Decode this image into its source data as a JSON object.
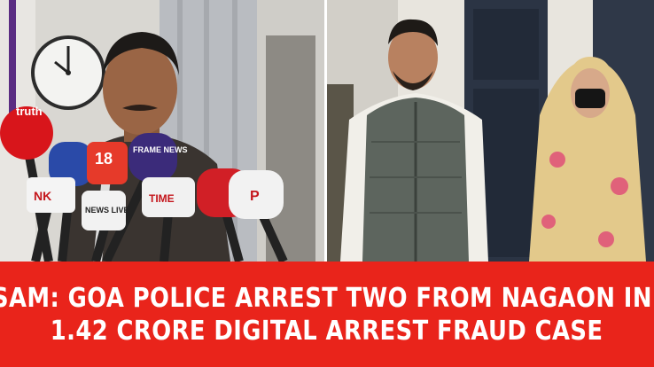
{
  "image": {
    "left_photo": {
      "scene": "speaker-at-press-microphones",
      "mic_labels": [
        "truth",
        "18",
        "FRAME NEWS",
        "NK",
        "NEWS LIVE",
        "TIME",
        "P"
      ]
    },
    "right_photo": {
      "scene": "two-people-standing-in-corridor"
    }
  },
  "headline": {
    "line1": "ASSAM: GOA POLICE ARREST TWO FROM NAGAON IN RS",
    "line2": "1.42 CRORE DIGITAL ARREST FRAUD CASE"
  },
  "colors": {
    "banner": "#e9241b",
    "headline_text": "#ffffff"
  }
}
